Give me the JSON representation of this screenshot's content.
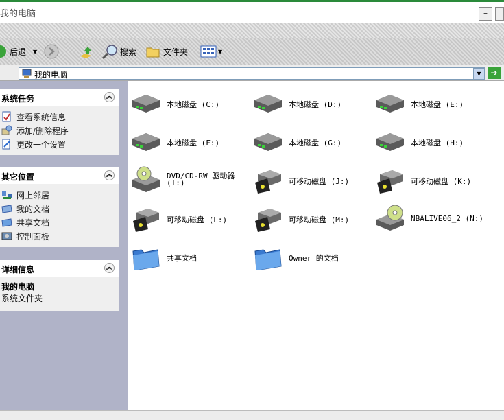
{
  "window": {
    "title": "我的电脑"
  },
  "menubar": {
    "items": []
  },
  "toolbar": {
    "back": "后退",
    "search": "搜索",
    "folders": "文件夹"
  },
  "address": {
    "value": "我的电脑"
  },
  "sidebar": {
    "system_tasks": {
      "title": "系统任务",
      "items": [
        {
          "label": "查看系统信息",
          "icon": "system-info-icon"
        },
        {
          "label": "添加/删除程序",
          "icon": "add-remove-programs-icon"
        },
        {
          "label": "更改一个设置",
          "icon": "change-setting-icon"
        }
      ]
    },
    "other_places": {
      "title": "其它位置",
      "items": [
        {
          "label": "网上邻居",
          "icon": "network-places-icon"
        },
        {
          "label": "我的文档",
          "icon": "my-documents-icon"
        },
        {
          "label": "共享文档",
          "icon": "shared-documents-icon"
        },
        {
          "label": "控制面板",
          "icon": "control-panel-icon"
        }
      ]
    },
    "details": {
      "title": "详细信息",
      "name": "我的电脑",
      "desc": "系统文件夹"
    }
  },
  "items": [
    {
      "label": "本地磁盘 (C:)",
      "type": "hdd"
    },
    {
      "label": "本地磁盘 (D:)",
      "type": "hdd"
    },
    {
      "label": "本地磁盘 (E:)",
      "type": "hdd"
    },
    {
      "label": "本地磁盘 (F:)",
      "type": "hdd"
    },
    {
      "label": "本地磁盘 (G:)",
      "type": "hdd"
    },
    {
      "label": "本地磁盘 (H:)",
      "type": "hdd"
    },
    {
      "label": "DVD/CD-RW 驱动器",
      "label2": "(I:)",
      "type": "dvd"
    },
    {
      "label": "可移动磁盘 (J:)",
      "type": "removable"
    },
    {
      "label": "可移动磁盘 (K:)",
      "type": "removable"
    },
    {
      "label": "可移动磁盘 (L:)",
      "type": "removable"
    },
    {
      "label": "可移动磁盘 (M:)",
      "type": "removable"
    },
    {
      "label": "NBALIVE06_2 (N:)",
      "type": "cd"
    },
    {
      "label": "共享文档",
      "type": "folder"
    },
    {
      "label": "Owner 的文档",
      "type": "folder"
    }
  ],
  "statusbar": {
    "text": ""
  }
}
